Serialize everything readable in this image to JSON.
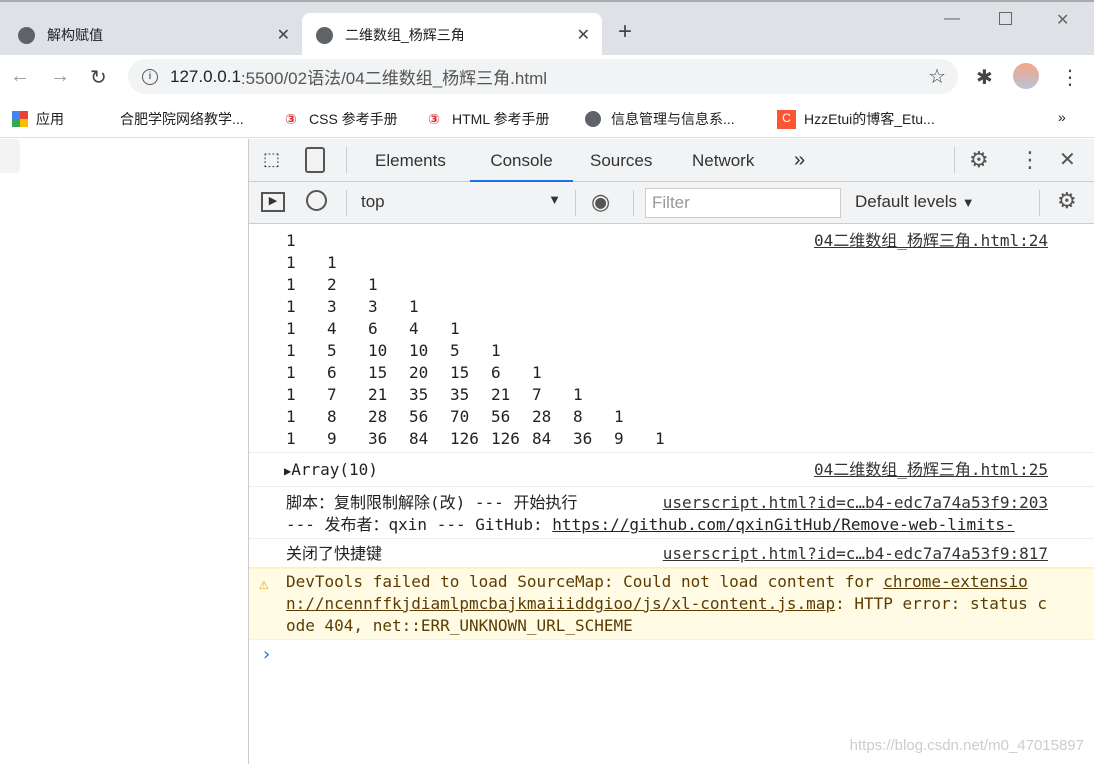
{
  "tabs": [
    {
      "title": "解构赋值"
    },
    {
      "title": "二维数组_杨辉三角",
      "active": true
    }
  ],
  "address": {
    "url_host": "127.0.0.1",
    "url_rest": ":5500/02语法/04二维数组_杨辉三角.html"
  },
  "bookmarks": [
    "应用",
    "合肥学院网络教学...",
    "CSS 参考手册",
    "HTML 参考手册",
    "信息管理与信息系...",
    "HzzEtui的博客_Etu..."
  ],
  "devtools": {
    "tabs": [
      "Elements",
      "Console",
      "Sources",
      "Network"
    ],
    "active_tab": "Console",
    "context": "top",
    "filter_placeholder": "Filter",
    "levels": "Default levels"
  },
  "console": {
    "triangle": [
      [
        "1"
      ],
      [
        "1",
        "1"
      ],
      [
        "1",
        "2",
        "1"
      ],
      [
        "1",
        "3",
        "3",
        "1"
      ],
      [
        "1",
        "4",
        "6",
        "4",
        "1"
      ],
      [
        "1",
        "5",
        "10",
        "10",
        "5",
        "1"
      ],
      [
        "1",
        "6",
        "15",
        "20",
        "15",
        "6",
        "1"
      ],
      [
        "1",
        "7",
        "21",
        "35",
        "35",
        "21",
        "7",
        "1"
      ],
      [
        "1",
        "8",
        "28",
        "56",
        "70",
        "56",
        "28",
        "8",
        "1"
      ],
      [
        "1",
        "9",
        "36",
        "84",
        "126",
        "126",
        "84",
        "36",
        "9",
        "1"
      ]
    ],
    "triangle_src": "04二维数组_杨辉三角.html:24",
    "array_label": "Array(10)",
    "array_src": "04二维数组_杨辉三角.html:25",
    "script_msg1": "脚本：复制限制解除(改) --- 开始执行",
    "script_src1": "userscript.html?id=c…b4-edc7a74a53f9:203",
    "script_msg2": "--- 发布者：qxin --- GitHub: ",
    "script_link": "https://github.com/qxinGitHub/Remove-web-limits-",
    "shortcut_msg": "关闭了快捷键",
    "shortcut_src": "userscript.html?id=c…b4-edc7a74a53f9:817",
    "warn_text1": "DevTools failed to load SourceMap: Could not load content for ",
    "warn_link": "chrome-extension://ncennffkjdiamlpmcbajkmaiiiddgioo/js/xl-content.js.map",
    "warn_text2": ": HTTP error: status code 404, net::ERR_UNKNOWN_URL_SCHEME"
  },
  "watermark": "https://blog.csdn.net/m0_47015897"
}
